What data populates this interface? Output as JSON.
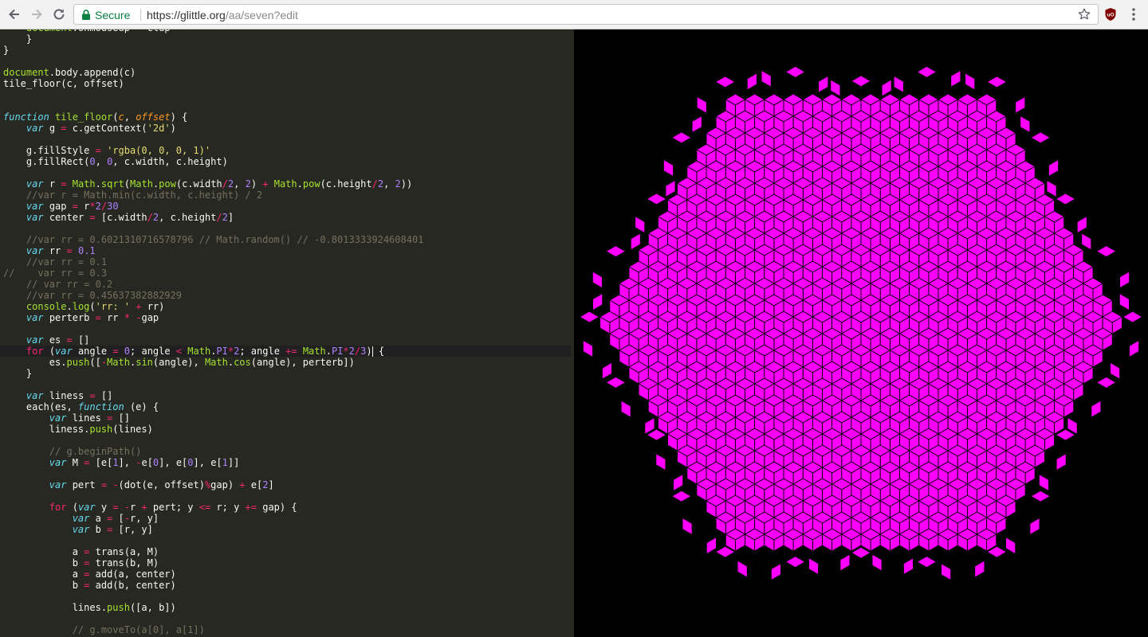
{
  "browser": {
    "secure_label": "Secure",
    "url_host": "https://glittle.org",
    "url_path": "/aa/seven?edit",
    "back_icon": "arrow-left-icon",
    "forward_icon": "arrow-right-icon",
    "reload_icon": "reload-icon",
    "lock_icon": "lock-icon",
    "star_icon": "star-icon",
    "extension_icon": "ublock-icon",
    "menu_icon": "kebab-menu-icon"
  },
  "editor": {
    "theme": "monokai",
    "colors": {
      "background": "#272822",
      "keyword": "#66d9ef",
      "function": "#a6e22e",
      "string": "#e6db74",
      "number": "#ae81ff",
      "operator": "#f92672",
      "comment": "#75715e",
      "param": "#fd971f"
    },
    "lines": [
      [
        [
          "    ",
          ""
        ],
        [
          "document",
          "gr"
        ],
        [
          ".onmouseup = clup",
          ""
        ]
      ],
      [
        [
          "    }",
          ""
        ]
      ],
      [
        [
          "}",
          ""
        ]
      ],
      [],
      [
        [
          "document",
          "gr"
        ],
        [
          ".body.append(c)",
          ""
        ]
      ],
      [
        [
          "tile_floor(c, offset)",
          ""
        ]
      ],
      [],
      [],
      [
        [
          "function",
          "kw"
        ],
        [
          " ",
          ""
        ],
        [
          "tile_floor",
          "fn"
        ],
        [
          "(",
          ""
        ],
        [
          "c",
          "pm"
        ],
        [
          ", ",
          ""
        ],
        [
          "offset",
          "pm"
        ],
        [
          ") {",
          ""
        ]
      ],
      [
        [
          "    ",
          ""
        ],
        [
          "var",
          "kw"
        ],
        [
          " g ",
          ""
        ],
        [
          "=",
          "op"
        ],
        [
          " c.getContext(",
          ""
        ],
        [
          "'2d'",
          "st"
        ],
        [
          ")",
          ""
        ]
      ],
      [],
      [
        [
          "    g.fillStyle ",
          ""
        ],
        [
          "=",
          "op"
        ],
        [
          " ",
          ""
        ],
        [
          "'rgba(0, 0, 0, 1)'",
          "st"
        ]
      ],
      [
        [
          "    g.fillRect(",
          ""
        ],
        [
          "0",
          "nm"
        ],
        [
          ", ",
          ""
        ],
        [
          "0",
          "nm"
        ],
        [
          ", c.width, c.height)",
          ""
        ]
      ],
      [],
      [
        [
          "    ",
          ""
        ],
        [
          "var",
          "kw"
        ],
        [
          " r ",
          ""
        ],
        [
          "=",
          "op"
        ],
        [
          " ",
          ""
        ],
        [
          "Math",
          "fn"
        ],
        [
          ".",
          ""
        ],
        [
          "sqrt",
          "fn"
        ],
        [
          "(",
          ""
        ],
        [
          "Math",
          "fn"
        ],
        [
          ".",
          ""
        ],
        [
          "pow",
          "fn"
        ],
        [
          "(c.width",
          ""
        ],
        [
          "/",
          "op"
        ],
        [
          "2",
          "nm"
        ],
        [
          ", ",
          ""
        ],
        [
          "2",
          "nm"
        ],
        [
          ") ",
          ""
        ],
        [
          "+",
          "op"
        ],
        [
          " ",
          ""
        ],
        [
          "Math",
          "fn"
        ],
        [
          ".",
          ""
        ],
        [
          "pow",
          "fn"
        ],
        [
          "(c.height",
          ""
        ],
        [
          "/",
          "op"
        ],
        [
          "2",
          "nm"
        ],
        [
          ", ",
          ""
        ],
        [
          "2",
          "nm"
        ],
        [
          "))",
          ""
        ]
      ],
      [
        [
          "    //var r = Math.min(c.width, c.height) / 2",
          "cm"
        ]
      ],
      [
        [
          "    ",
          ""
        ],
        [
          "var",
          "kw"
        ],
        [
          " gap ",
          ""
        ],
        [
          "=",
          "op"
        ],
        [
          " r",
          ""
        ],
        [
          "*",
          "op"
        ],
        [
          "2",
          "nm"
        ],
        [
          "/",
          "op"
        ],
        [
          "30",
          "nm"
        ]
      ],
      [
        [
          "    ",
          ""
        ],
        [
          "var",
          "kw"
        ],
        [
          " center ",
          ""
        ],
        [
          "=",
          "op"
        ],
        [
          " [c.width",
          ""
        ],
        [
          "/",
          "op"
        ],
        [
          "2",
          "nm"
        ],
        [
          ", c.height",
          ""
        ],
        [
          "/",
          "op"
        ],
        [
          "2",
          "nm"
        ],
        [
          "]",
          ""
        ]
      ],
      [],
      [
        [
          "    //var rr = 0.6021310716578796 // Math.random() // -0.8013333924608401",
          "cm"
        ]
      ],
      [
        [
          "    ",
          ""
        ],
        [
          "var",
          "kw"
        ],
        [
          " rr ",
          ""
        ],
        [
          "=",
          "op"
        ],
        [
          " ",
          ""
        ],
        [
          "0.1",
          "nm"
        ]
      ],
      [
        [
          "    //var rr = 0.1",
          "cm"
        ]
      ],
      [
        [
          "//    var rr = 0.3",
          "cm"
        ]
      ],
      [
        [
          "    // var rr = 0.2",
          "cm"
        ]
      ],
      [
        [
          "    //var rr = 0.45637382882929",
          "cm"
        ]
      ],
      [
        [
          "    ",
          ""
        ],
        [
          "console",
          "fn"
        ],
        [
          ".",
          ""
        ],
        [
          "log",
          "fn"
        ],
        [
          "(",
          ""
        ],
        [
          "'rr: '",
          "st"
        ],
        [
          " ",
          ""
        ],
        [
          "+",
          "op"
        ],
        [
          " rr)",
          ""
        ]
      ],
      [
        [
          "    ",
          ""
        ],
        [
          "var",
          "kw"
        ],
        [
          " perterb ",
          ""
        ],
        [
          "=",
          "op"
        ],
        [
          " rr ",
          ""
        ],
        [
          "*",
          "op"
        ],
        [
          " ",
          ""
        ],
        [
          "-",
          "op"
        ],
        [
          "gap",
          ""
        ]
      ],
      [],
      [
        [
          "    ",
          ""
        ],
        [
          "var",
          "kw"
        ],
        [
          " es ",
          ""
        ],
        [
          "=",
          "op"
        ],
        [
          " []",
          ""
        ]
      ],
      [
        [
          "    ",
          ""
        ],
        [
          "for",
          "op"
        ],
        [
          " (",
          ""
        ],
        [
          "var",
          "kw"
        ],
        [
          " angle ",
          ""
        ],
        [
          "=",
          "op"
        ],
        [
          " ",
          ""
        ],
        [
          "0",
          "nm"
        ],
        [
          "; angle ",
          ""
        ],
        [
          "<",
          "op"
        ],
        [
          " ",
          ""
        ],
        [
          "Math",
          "fn"
        ],
        [
          ".",
          ""
        ],
        [
          "PI",
          "nm"
        ],
        [
          "*",
          "op"
        ],
        [
          "2",
          "nm"
        ],
        [
          "; angle ",
          ""
        ],
        [
          "+=",
          "op"
        ],
        [
          " ",
          ""
        ],
        [
          "Math",
          "fn"
        ],
        [
          ".",
          ""
        ],
        [
          "PI",
          "nm"
        ],
        [
          "*",
          "op"
        ],
        [
          "2",
          "nm"
        ],
        [
          "/",
          "op"
        ],
        [
          "3",
          "nm"
        ],
        [
          ")",
          ""
        ],
        [
          "|",
          "cursor"
        ],
        [
          " {",
          ""
        ]
      ],
      [
        [
          "        es.",
          ""
        ],
        [
          "push",
          "fn"
        ],
        [
          "([",
          ""
        ],
        [
          "-",
          "op"
        ],
        [
          "Math",
          "fn"
        ],
        [
          ".",
          ""
        ],
        [
          "sin",
          "fn"
        ],
        [
          "(angle), ",
          ""
        ],
        [
          "Math",
          "fn"
        ],
        [
          ".",
          ""
        ],
        [
          "cos",
          "fn"
        ],
        [
          "(angle), perterb])",
          ""
        ]
      ],
      [
        [
          "    }",
          ""
        ]
      ],
      [],
      [
        [
          "    ",
          ""
        ],
        [
          "var",
          "kw"
        ],
        [
          " liness ",
          ""
        ],
        [
          "=",
          "op"
        ],
        [
          " []",
          ""
        ]
      ],
      [
        [
          "    each(es, ",
          ""
        ],
        [
          "function",
          "kw"
        ],
        [
          " (e) {",
          ""
        ]
      ],
      [
        [
          "        ",
          ""
        ],
        [
          "var",
          "kw"
        ],
        [
          " lines ",
          ""
        ],
        [
          "=",
          "op"
        ],
        [
          " []",
          ""
        ]
      ],
      [
        [
          "        liness.",
          ""
        ],
        [
          "push",
          "fn"
        ],
        [
          "(lines)",
          ""
        ]
      ],
      [],
      [
        [
          "        // g.beginPath()",
          "cm"
        ]
      ],
      [
        [
          "        ",
          ""
        ],
        [
          "var",
          "kw"
        ],
        [
          " M ",
          ""
        ],
        [
          "=",
          "op"
        ],
        [
          " [e[",
          ""
        ],
        [
          "1",
          "nm"
        ],
        [
          "], ",
          ""
        ],
        [
          "-",
          "op"
        ],
        [
          "e[",
          ""
        ],
        [
          "0",
          "nm"
        ],
        [
          "], e[",
          ""
        ],
        [
          "0",
          "nm"
        ],
        [
          "], e[",
          ""
        ],
        [
          "1",
          "nm"
        ],
        [
          "]]",
          ""
        ]
      ],
      [],
      [
        [
          "        ",
          ""
        ],
        [
          "var",
          "kw"
        ],
        [
          " pert ",
          ""
        ],
        [
          "=",
          "op"
        ],
        [
          " ",
          ""
        ],
        [
          "-",
          "op"
        ],
        [
          "(dot(e, offset)",
          ""
        ],
        [
          "%",
          "op"
        ],
        [
          "gap) ",
          ""
        ],
        [
          "+",
          "op"
        ],
        [
          " e[",
          ""
        ],
        [
          "2",
          "nm"
        ],
        [
          "]",
          ""
        ]
      ],
      [],
      [
        [
          "        ",
          ""
        ],
        [
          "for",
          "op"
        ],
        [
          " (",
          ""
        ],
        [
          "var",
          "kw"
        ],
        [
          " y ",
          ""
        ],
        [
          "=",
          "op"
        ],
        [
          " ",
          ""
        ],
        [
          "-",
          "op"
        ],
        [
          "r ",
          ""
        ],
        [
          "+",
          "op"
        ],
        [
          " pert; y ",
          ""
        ],
        [
          "<=",
          "op"
        ],
        [
          " r; y ",
          ""
        ],
        [
          "+=",
          "op"
        ],
        [
          " gap) {",
          ""
        ]
      ],
      [
        [
          "            ",
          ""
        ],
        [
          "var",
          "kw"
        ],
        [
          " a ",
          ""
        ],
        [
          "=",
          "op"
        ],
        [
          " [",
          ""
        ],
        [
          "-",
          "op"
        ],
        [
          "r, y]",
          ""
        ]
      ],
      [
        [
          "            ",
          ""
        ],
        [
          "var",
          "kw"
        ],
        [
          " b ",
          ""
        ],
        [
          "=",
          "op"
        ],
        [
          " [r, y]",
          ""
        ]
      ],
      [],
      [
        [
          "            a ",
          ""
        ],
        [
          "=",
          "op"
        ],
        [
          " trans(a, M)",
          ""
        ]
      ],
      [
        [
          "            b ",
          ""
        ],
        [
          "=",
          "op"
        ],
        [
          " trans(b, M)",
          ""
        ]
      ],
      [
        [
          "            a ",
          ""
        ],
        [
          "=",
          "op"
        ],
        [
          " add(a, center)",
          ""
        ]
      ],
      [
        [
          "            b ",
          ""
        ],
        [
          "=",
          "op"
        ],
        [
          " add(b, center)",
          ""
        ]
      ],
      [],
      [
        [
          "            lines.",
          ""
        ],
        [
          "push",
          "fn"
        ],
        [
          "([a, b])",
          ""
        ]
      ],
      [],
      [
        [
          "            // g.moveTo(a[0], a[1])",
          "cm"
        ]
      ]
    ],
    "active_line": 29
  },
  "canvas": {
    "background": "#000000",
    "fill": "#ff00ff",
    "stroke": "#000000",
    "description_icon": "rhombille-tiling-render"
  }
}
